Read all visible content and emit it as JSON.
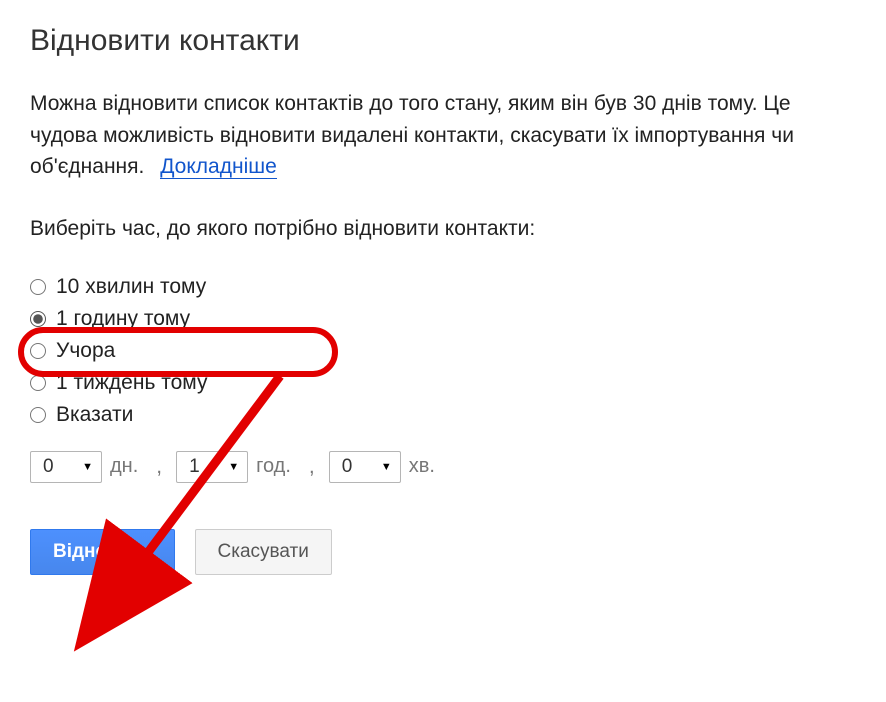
{
  "title": "Відновити контакти",
  "description": "Можна відновити список контактів до того стану, яким він був 30 днів тому. Це чудова можливість відновити видалені контакти, скасувати їх імпортування чи об'єднання.",
  "learn_more": "Докладніше",
  "prompt": "Виберіть час, до якого потрібно відновити контакти:",
  "options": [
    {
      "label": "10 хвилин тому",
      "selected": false
    },
    {
      "label": "1 годину тому",
      "selected": true
    },
    {
      "label": "Учора",
      "selected": false
    },
    {
      "label": "1 тиждень тому",
      "selected": false
    },
    {
      "label": "Вказати",
      "selected": false
    }
  ],
  "custom_time": {
    "days": {
      "value": "0",
      "unit": "дн."
    },
    "hours": {
      "value": "1",
      "unit": "год."
    },
    "minutes": {
      "value": "0",
      "unit": "хв."
    }
  },
  "buttons": {
    "primary": "Відновити",
    "secondary": "Скасувати"
  },
  "annotations": {
    "highlight_option_index": 1
  }
}
